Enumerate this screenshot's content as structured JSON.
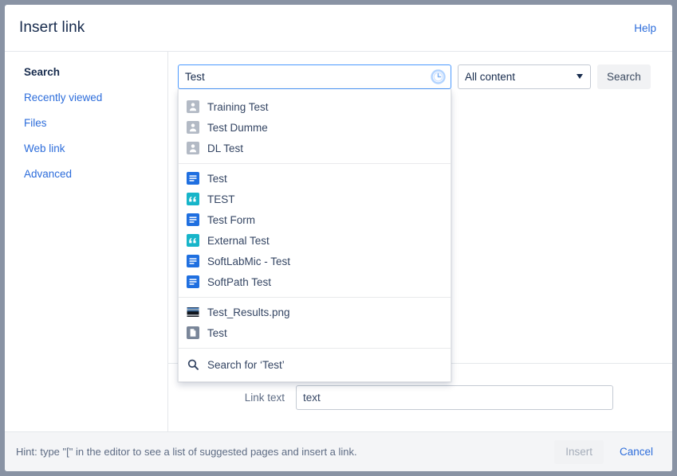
{
  "dialog": {
    "title": "Insert link",
    "help_label": "Help"
  },
  "sidebar": {
    "items": [
      {
        "label": "Search",
        "active": true
      },
      {
        "label": "Recently viewed",
        "active": false
      },
      {
        "label": "Files",
        "active": false
      },
      {
        "label": "Web link",
        "active": false
      },
      {
        "label": "Advanced",
        "active": false
      }
    ]
  },
  "search": {
    "value": "Test",
    "placeholder": "Search",
    "recent_icon": "clock-icon",
    "scope_value": "All content",
    "search_button": "Search"
  },
  "dropdown": {
    "groups": [
      {
        "name": "people",
        "items": [
          {
            "icon": "person-icon",
            "label": "Training Test"
          },
          {
            "icon": "person-icon",
            "label": "Test Dumme"
          },
          {
            "icon": "person-icon",
            "label": "DL Test"
          }
        ]
      },
      {
        "name": "content",
        "items": [
          {
            "icon": "page-icon",
            "label": "Test"
          },
          {
            "icon": "blog-icon",
            "label": "TEST"
          },
          {
            "icon": "page-icon",
            "label": "Test Form"
          },
          {
            "icon": "blog-icon",
            "label": "External Test"
          },
          {
            "icon": "page-icon",
            "label": "SoftLabMic - Test"
          },
          {
            "icon": "page-icon",
            "label": "SoftPath Test"
          }
        ]
      },
      {
        "name": "attachments",
        "items": [
          {
            "icon": "image-thumbnail-icon",
            "label": "Test_Results.png"
          },
          {
            "icon": "file-icon",
            "label": "Test"
          }
        ]
      }
    ],
    "search_more": {
      "icon": "magnifier-icon",
      "label": "Search for ‘Test’"
    }
  },
  "link_text": {
    "label": "Link text",
    "value": "text",
    "placeholder": "text"
  },
  "footer": {
    "hint": "Hint: type \"[\" in the editor to see a list of suggested pages and insert a link.",
    "insert_label": "Insert",
    "cancel_label": "Cancel"
  },
  "colors": {
    "accent_link": "#2d6ddb",
    "page_icon": "#1f6fe0",
    "blog_icon": "#17b5c9",
    "person_icon": "#a5adba",
    "focus_border": "#4c9aff",
    "backdrop": "#8993a4"
  }
}
